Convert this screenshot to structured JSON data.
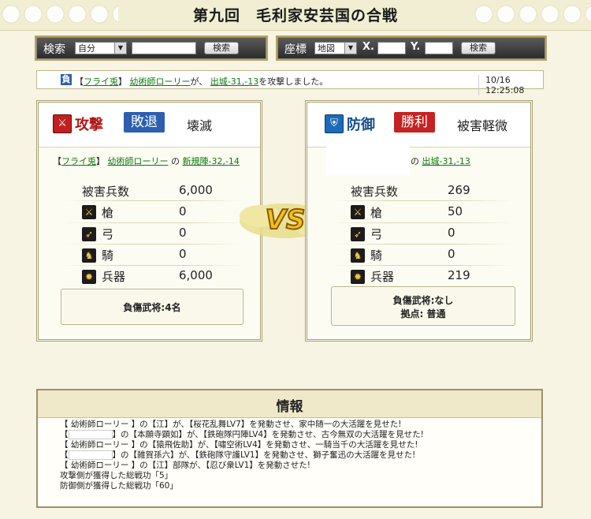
{
  "page_title": "第九回　毛利家安芸国の合戦",
  "search_bar": {
    "label": "検索",
    "select_value": "自分",
    "input_value": "",
    "button_label": "検索"
  },
  "coord_bar": {
    "label": "座標",
    "select_value": "地図",
    "x_label": "X.",
    "x_value": "",
    "y_label": "Y.",
    "y_value": "",
    "button_label": "検索"
  },
  "log": {
    "badge": "負",
    "bracket_open": "【",
    "team": "フライ兎",
    "bracket_close": "】",
    "actor": "幼術師ローリー",
    "particle": "が、",
    "target": "出城-31,-13",
    "tail": "を攻撃しました。",
    "timestamp": "10/16 12:25:08"
  },
  "attack": {
    "role": "攻撃",
    "result": "敗退",
    "status": "壊滅",
    "bracket_open": "【",
    "team": "フライ兎",
    "bracket_close": "】",
    "actor": "幼術師ローリー",
    "particle": "の",
    "base": "新規陣-32,-14",
    "damage_label": "被害兵数",
    "damage_value": "6,000",
    "units": [
      {
        "icon": "spear-icon",
        "label": "槍",
        "value": "0"
      },
      {
        "icon": "bow-icon",
        "label": "弓",
        "value": "0"
      },
      {
        "icon": "horse-icon",
        "label": "騎",
        "value": "0"
      },
      {
        "icon": "siege-icon",
        "label": "兵器",
        "value": "6,000"
      }
    ],
    "injured": "負傷武将:4名"
  },
  "vs_label": "VS",
  "defense": {
    "role": "防御",
    "result": "勝利",
    "status": "被害軽微",
    "particle": "の",
    "base": "出城-31,-13",
    "damage_label": "被害兵数",
    "damage_value": "269",
    "units": [
      {
        "icon": "spear-icon",
        "label": "槍",
        "value": "50"
      },
      {
        "icon": "bow-icon",
        "label": "弓",
        "value": "0"
      },
      {
        "icon": "horse-icon",
        "label": "騎",
        "value": "0"
      },
      {
        "icon": "siege-icon",
        "label": "兵器",
        "value": "219"
      }
    ],
    "injured": "負傷武将:なし",
    "stronghold": "拠点: 普通"
  },
  "info": {
    "heading": "情報",
    "lines": [
      "【 幼術師ローリー 】の【江】が、【桜花乱舞LV7】を発動させ、家中随一の大活躍を見せた!",
      "の【本願寺顕如】が、【鉄砲隊円陣LV4】を発動させ、古今無双の大活躍を見せた!",
      "【 幼術師ローリー 】の【猿飛佐助】が、【嘯空術LV4】を発動させ、一騎当千の大活躍を見せた!",
      "の【雑賀孫六】が、【鉄砲隊守護LV1】を発動させ、獅子奮迅の大活躍を見せた!",
      "【 幼術師ローリー 】の【江】部隊が、【忍び衆LV1】を発動させた!",
      "攻撃側が獲得した総戦功「5」",
      "防御側が獲得した総戦功「60」"
    ],
    "line_prefix_2": "【",
    "line_suffix_2": "】",
    "line_prefix_4": "【",
    "line_suffix_4": "】"
  },
  "colors": {
    "background": "#f7f4e3",
    "lose_badge": "#2b5fb3",
    "attack_result": "#2d5fae",
    "defense_result": "#c52222",
    "link_green": "#0b7a0b"
  }
}
